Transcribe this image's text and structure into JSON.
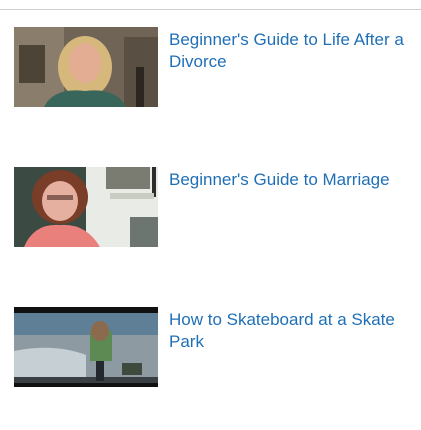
{
  "related_videos": [
    {
      "title": "Beginner's Guide to Life After a Divorce",
      "thumbnail": "woman-blonde-talking-thumbnail"
    },
    {
      "title": "Beginner's Guide to Marriage",
      "thumbnail": "woman-glasses-talking-thumbnail"
    },
    {
      "title": "How to Skateboard at a Skate Park",
      "thumbnail": "skate-park-thumbnail"
    }
  ],
  "colors": {
    "link": "#1f6fb6",
    "divider": "#cfcfcf"
  }
}
